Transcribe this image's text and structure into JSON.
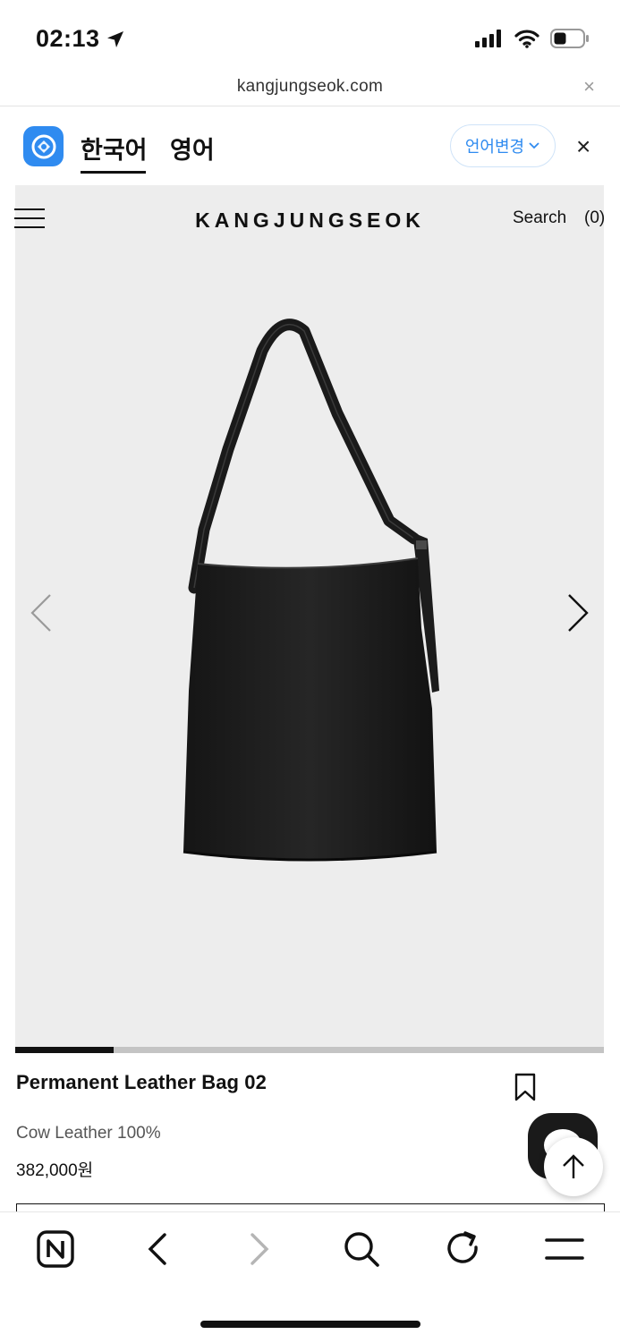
{
  "status_bar": {
    "time": "02:13"
  },
  "address_bar": {
    "url": "kangjungseok.com",
    "close_symbol": "×"
  },
  "translator": {
    "languages": [
      "한국어",
      "영어"
    ],
    "active_language": "한국어",
    "change_language_label": "언어변경",
    "close_symbol": "×",
    "accent_color": "#2f8bf0"
  },
  "site_header": {
    "brand": "KANGJUNGSEOK",
    "search_label": "Search",
    "cart_label": "(0)"
  },
  "gallery": {
    "image_alt": "black leather bag",
    "slide_progress": 0.167
  },
  "product": {
    "title": "Permanent Leather Bag 02",
    "material": "Cow Leather 100%",
    "price": "382,000원"
  },
  "bottom_toolbar": {
    "items": [
      "naver-home-icon",
      "back-icon",
      "forward-icon",
      "search-icon",
      "refresh-icon",
      "menu-icon"
    ]
  }
}
